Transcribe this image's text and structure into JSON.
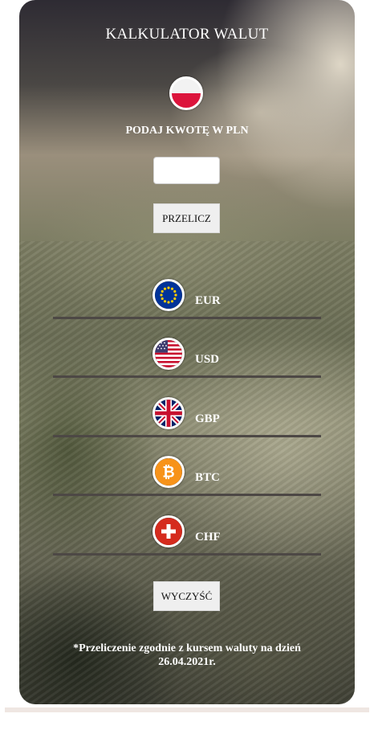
{
  "app": {
    "title": "KALKULATOR WALUT"
  },
  "input_section": {
    "flag_icon": "poland-flag-icon",
    "prompt": "PODAJ KWOTĘ W PLN",
    "amount_value": "",
    "amount_placeholder": "",
    "convert_label": "PRZELICZ"
  },
  "currencies": [
    {
      "code": "EUR",
      "icon": "eu-flag-icon",
      "result": ""
    },
    {
      "code": "USD",
      "icon": "us-flag-icon",
      "result": ""
    },
    {
      "code": "GBP",
      "icon": "uk-flag-icon",
      "result": ""
    },
    {
      "code": "BTC",
      "icon": "bitcoin-icon",
      "result": ""
    },
    {
      "code": "CHF",
      "icon": "swiss-flag-icon",
      "result": ""
    }
  ],
  "actions": {
    "clear_label": "WYCZYŚĆ"
  },
  "footer": {
    "note": "*Przeliczenie zgodnie z kursem waluty na dzień 26.04.2021r."
  },
  "colors": {
    "text": "#ffffff",
    "button_bg": "#efefef",
    "separator": "#4d4845",
    "pl_red": "#dc143c",
    "eu_blue": "#003399",
    "eu_gold": "#ffcc00",
    "btc_orange": "#f7931a",
    "chf_red": "#d52b1e"
  }
}
